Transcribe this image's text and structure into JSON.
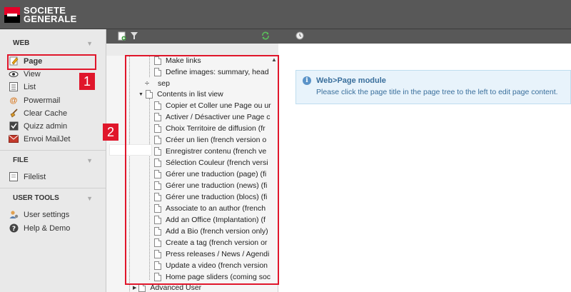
{
  "brand": {
    "line1": "SOCIETE",
    "line2": "GENERALE"
  },
  "sidebar": {
    "web": {
      "title": "WEB",
      "items": [
        {
          "label": "Page",
          "icon": "page-icon"
        },
        {
          "label": "View",
          "icon": "eye-icon"
        },
        {
          "label": "List",
          "icon": "list-icon"
        },
        {
          "label": "Powermail",
          "icon": "at-icon"
        },
        {
          "label": "Clear Cache",
          "icon": "broom-icon"
        },
        {
          "label": "Quizz admin",
          "icon": "quiz-icon"
        },
        {
          "label": "Envoi MailJet",
          "icon": "mail-icon"
        }
      ]
    },
    "file": {
      "title": "FILE",
      "items": [
        {
          "label": "Filelist",
          "icon": "filelist-icon"
        }
      ]
    },
    "user_tools": {
      "title": "USER TOOLS",
      "items": [
        {
          "label": "User settings",
          "icon": "user-settings-icon"
        },
        {
          "label": "Help & Demo",
          "icon": "help-icon"
        }
      ]
    }
  },
  "callouts": [
    "1",
    "2"
  ],
  "tree": {
    "items": [
      {
        "label": "Make links",
        "level": 2
      },
      {
        "label": "Define images: summary, head",
        "level": 2
      },
      {
        "label": "sep",
        "level": 1,
        "separator": true
      },
      {
        "label": "Contents in list view",
        "level": 1,
        "expanded": true
      },
      {
        "label": "Copier et Coller une Page ou ur",
        "level": 2
      },
      {
        "label": "Activer / Désactiver une Page c",
        "level": 2
      },
      {
        "label": "Choix Territoire de diffusion (fr",
        "level": 2
      },
      {
        "label": "Créer un lien (french version o",
        "level": 2
      },
      {
        "label": "Enregistrer contenu (french ve",
        "level": 2
      },
      {
        "label": "Sélection Couleur (french versi",
        "level": 2
      },
      {
        "label": "Gérer une traduction (page) (fi",
        "level": 2
      },
      {
        "label": "Gérer une traduction (news) (fi",
        "level": 2
      },
      {
        "label": "Gérer une traduction (blocs) (fi",
        "level": 2
      },
      {
        "label": "Associate to an author (french",
        "level": 2
      },
      {
        "label": "Add an Office (Implantation) (f",
        "level": 2
      },
      {
        "label": "Add a Bio (french version only)",
        "level": 2
      },
      {
        "label": "Create a tag (french version or",
        "level": 2
      },
      {
        "label": "Press releases / News / Agendi",
        "level": 2
      },
      {
        "label": "Update a video (french version",
        "level": 2
      },
      {
        "label": "Home page sliders (coming soc",
        "level": 2
      },
      {
        "label": "Advanced User",
        "level": 0
      }
    ]
  },
  "info": {
    "title": "Web>Page module",
    "text": "Please click the page title in the page tree to the left to edit page content."
  },
  "colors": {
    "accent_red": "#e0162b",
    "info_blue": "#3a6f9c",
    "topbar": "#585858"
  }
}
